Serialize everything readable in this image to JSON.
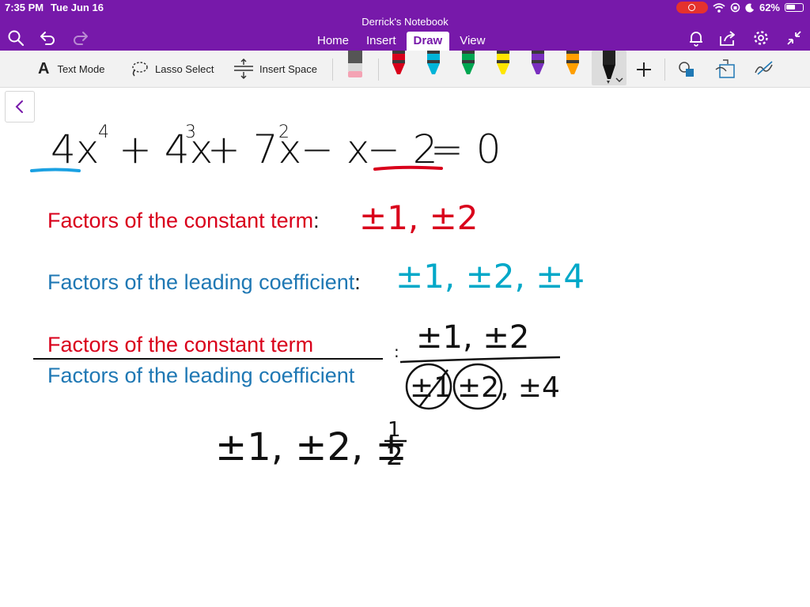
{
  "status": {
    "time": "7:35 PM",
    "date": "Tue Jun 16",
    "battery": "62%",
    "battery_level": 0.62
  },
  "app": {
    "notebook_title": "Derrick's Notebook",
    "tabs": [
      {
        "label": "Home",
        "active": false
      },
      {
        "label": "Insert",
        "active": false
      },
      {
        "label": "Draw",
        "active": true
      },
      {
        "label": "View",
        "active": false
      }
    ],
    "accent": "#7719aa"
  },
  "toolbar": {
    "text_mode": "Text Mode",
    "lasso_select": "Lasso Select",
    "insert_space": "Insert Space",
    "pen_colors": [
      "#d9001b",
      "#00b4d8",
      "#00a651",
      "#ffe600",
      "#7a2fbf",
      "#ff9f00",
      "#111111"
    ]
  },
  "page": {
    "equation": {
      "t1": "4x",
      "e1": "4",
      "t2": "+ 4x",
      "e2": "3",
      "t3": "+ 7x",
      "e3": "2",
      "t4": "− x",
      "t5": "− 2",
      "t6": "= 0"
    },
    "constant_label": "Factors of the constant term",
    "colon": ":",
    "constant_factors": "±1, ±2",
    "leading_label": "Factors of the leading coefficient",
    "leading_factors": "±1, ±2, ±4",
    "fraction_numerator": "Factors of the constant term",
    "fraction_denominator": "Factors of the leading coefficient",
    "ratio_numerator": "±1, ±2",
    "ratio_d1": "±1",
    "ratio_d2": "±2",
    "ratio_d3": ", ±4",
    "result_a": "±1,  ±2,  ±",
    "result_num": "1",
    "result_den": "2"
  }
}
